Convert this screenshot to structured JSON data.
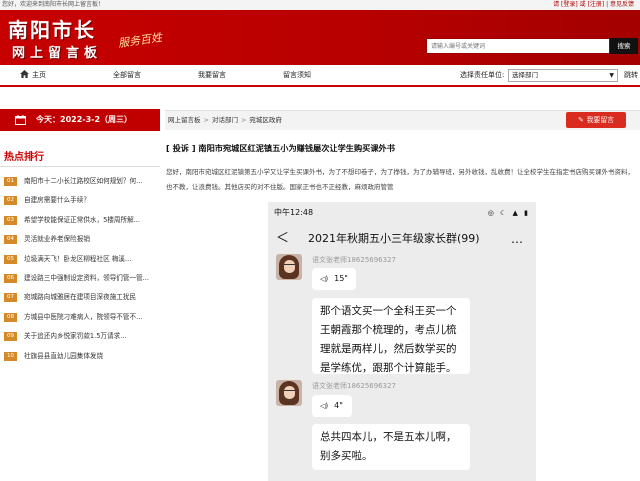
{
  "topbar": {
    "welcome": "您好，欢迎来到南阳市长网上留言板！",
    "auth": "请 [登录] 或 [注册]  |  意见反馈"
  },
  "banner": {
    "logo_line1": "南阳市长",
    "logo_line2": "网上留言板",
    "slogan": "服务百姓",
    "search_placeholder": "请输入编号或关键词",
    "search_button": "搜索"
  },
  "nav": {
    "home": "主页",
    "all_messages": "全部留言",
    "post_message": "我要留言",
    "notice": "留言须知",
    "select_label": "选择责任单位:",
    "select_value": "选择部门",
    "jump": "跳转"
  },
  "sidebar": {
    "date": "今天：2022-3-2（周三）",
    "hot_title": "热点排行",
    "hot_items": [
      {
        "num": "01",
        "text": "南阳市十二小长江路校区如何规划？何..."
      },
      {
        "num": "02",
        "text": "自建房需要什么手续？"
      },
      {
        "num": "03",
        "text": "希望学校能保证正常供水，5楼周所解..."
      },
      {
        "num": "04",
        "text": "灵活就业养老保险报销"
      },
      {
        "num": "05",
        "text": "垃圾满天飞！卧龙区柳程社区 梅溪..."
      },
      {
        "num": "06",
        "text": "建设路三中强制设定资料，领导们管一管..."
      },
      {
        "num": "07",
        "text": "宛城路向城雅居在建项目深夜施工扰民"
      },
      {
        "num": "08",
        "text": "方城县中医院刁难病人，院领导不管不..."
      },
      {
        "num": "09",
        "text": "关于追还内乡悦家罚款1.5万请求..."
      },
      {
        "num": "10",
        "text": "社旗县县直幼儿园集体发烧"
      }
    ]
  },
  "main": {
    "breadcrumb": [
      "网上留言板",
      "对话部门",
      "宛城区政府"
    ],
    "post_button": "我要留言",
    "title": "[ 投诉 ] 南阳市宛城区红泥镇五小为赚钱屡次让学生购买课外书",
    "body": "您好，南阳市宛城区红泥镇第五小学又让学生买课外书，为了不想印卷子，为了挣钱，为了办辅导班，另外收钱，乱收费！让全校学生在指定书店购买课外书资料，也不教，让浪费钱。其他店买的对不住版。国家正书也不正经教，麻烦政府管管"
  },
  "phone": {
    "time": "中午12:48",
    "status_icons": "◎ ☾ ▲ ▮",
    "back": "＜",
    "group_title": "2021年秋期五小三年级家长群(99)",
    "more": "…",
    "messages": [
      {
        "sender": "语文张老师18625696327",
        "voice": "15\"",
        "text": "那个语文买一个全科王买一个王朝霞那个梳理的，考点儿梳理就是两样儿，然后数学买的是学练优，跟那个计算能手。"
      },
      {
        "sender": "语文张老师18625696327",
        "voice": "4\"",
        "text": "总共四本儿，不是五本儿啊，别多买啦。"
      }
    ]
  }
}
